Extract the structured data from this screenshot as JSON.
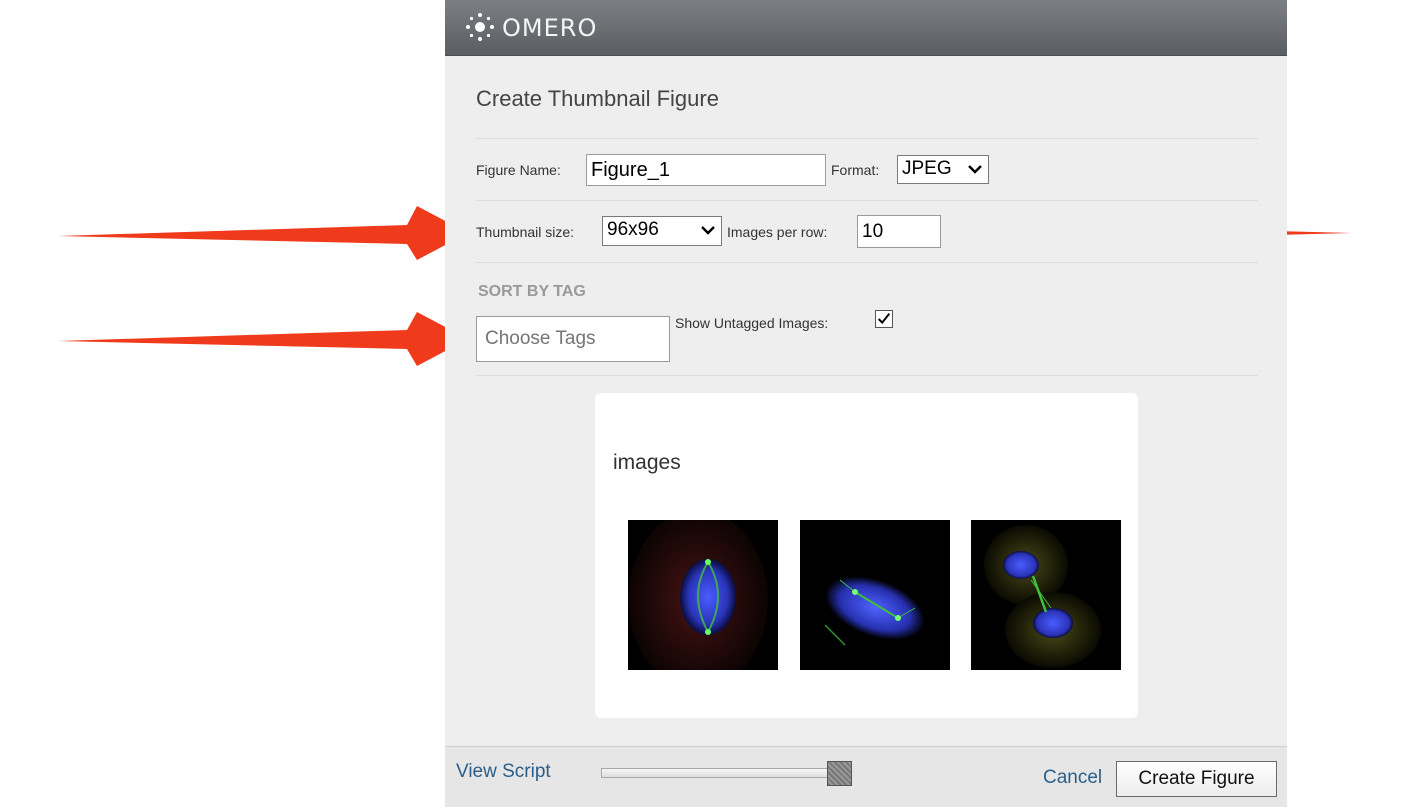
{
  "app": {
    "logo_text": "OMERO"
  },
  "dialog": {
    "title": "Create Thumbnail Figure"
  },
  "form": {
    "figure_name_label": "Figure Name:",
    "figure_name_value": "Figure_1",
    "format_label": "Format:",
    "format_value": "JPEG",
    "thumbnail_size_label": "Thumbnail size:",
    "thumbnail_size_value": "96x96",
    "images_per_row_label": "Images per row:",
    "images_per_row_value": "10",
    "sort_by_tag_heading": "SORT BY TAG",
    "choose_tags_placeholder": "Choose Tags",
    "show_untagged_label": "Show Untagged Images:",
    "show_untagged_checked": true
  },
  "preview": {
    "group_title": "images",
    "thumbnails": [
      "thumbnail-1",
      "thumbnail-2",
      "thumbnail-3"
    ]
  },
  "footer": {
    "view_script_label": "View Script",
    "cancel_label": "Cancel",
    "create_label": "Create Figure"
  },
  "colors": {
    "header": "#6b6e72",
    "link": "#2a5f8a",
    "annotation_arrow": "#f03a1c"
  }
}
